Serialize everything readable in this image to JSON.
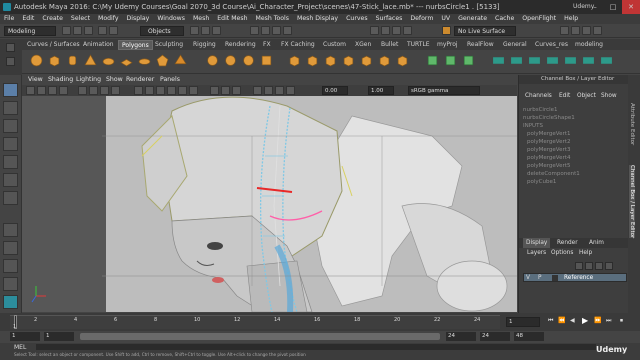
{
  "window": {
    "title": "Autodesk Maya 2016: C:\\My Udemy Courses\\Goal 2070_3d Course\\Ai_Character_Project\\scenes\\47-Stick_lace.mb*  ---  nurbsCircle1 . [5133]",
    "controls": [
      "–",
      "□",
      "✕"
    ]
  },
  "menu": [
    "File",
    "Edit",
    "Create",
    "Select",
    "Modify",
    "Display",
    "Windows",
    "Mesh",
    "Edit Mesh",
    "Mesh Tools",
    "Mesh Display",
    "Curves",
    "Surfaces",
    "Deform",
    "UV",
    "Generate",
    "Cache",
    "OpenFlight",
    "Help"
  ],
  "statusline": {
    "mode": "Modeling",
    "objects_label": "Objects",
    "live_surface": "No Live Surface"
  },
  "shelf_tabs": [
    "Curves / Surfaces",
    "Animation",
    "Polygons",
    "Sculpting",
    "Rigging",
    "Rendering",
    "FX",
    "FX Caching",
    "Custom",
    "XGen",
    "Bullet",
    "TURTLE",
    "myProj",
    "RealFlow",
    "General",
    "Curves_res",
    "modeling"
  ],
  "shelf_active": "Polygons",
  "viewport": {
    "menu": [
      "View",
      "Shading",
      "Lighting",
      "Show",
      "Renderer",
      "Panels"
    ],
    "gamma_value": "0.00",
    "gamma_value2": "1.00",
    "colorspace": "sRGB gamma"
  },
  "channel_box": {
    "header": "Channel Box / Layer Editor",
    "menu": [
      "Channels",
      "Edit",
      "Object",
      "Show"
    ],
    "shape": "nurbsCircle1",
    "items": [
      "nurbsCircleShape1",
      "INPUTS",
      "polyMergeVert1",
      "polyMergeVert2",
      "polyMergeVert3",
      "polyMergeVert4",
      "polyMergeVert5",
      "deleteComponent1",
      "polyCube1"
    ],
    "layer_tabs": [
      "Display",
      "Render",
      "Anim"
    ],
    "layer_menu": [
      "Layers",
      "Options",
      "Help"
    ],
    "layer": {
      "v": "V",
      "p": "P",
      "name": "Reference"
    }
  },
  "side_tabs": [
    "Attribute Editor",
    "Channel Box / Layer Editor"
  ],
  "timeline": {
    "ticks": [
      "1",
      "2",
      "4",
      "6",
      "8",
      "10",
      "12",
      "14",
      "16",
      "18",
      "20",
      "22",
      "24"
    ],
    "current_frame": "1"
  },
  "range": {
    "start": "1",
    "inner_start": "1",
    "inner_end": "24",
    "end": "24",
    "end2": "48"
  },
  "mel": {
    "label": "MEL",
    "help": "Select Tool: select an object or component. Use Shift to add, Ctrl to remove, Shift+Ctrl to toggle. Use Alt+click to change the pivot position"
  },
  "brand": "Udemy",
  "colors": {
    "accent": "#5b7fa8",
    "active_tab": "#5b5b5b"
  }
}
